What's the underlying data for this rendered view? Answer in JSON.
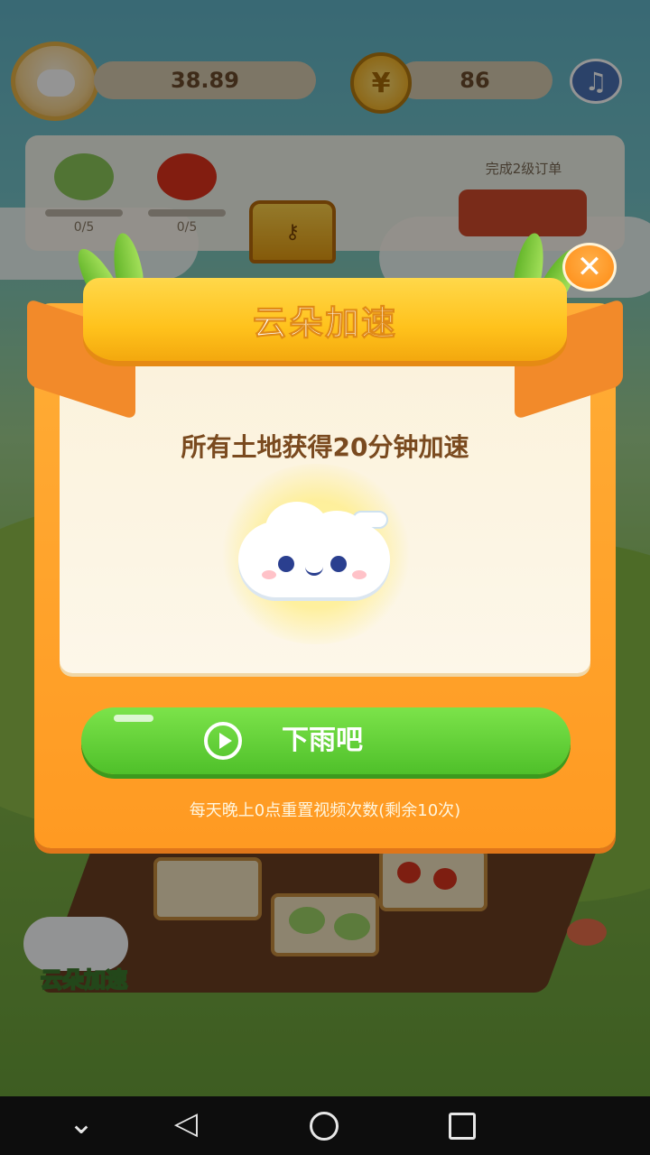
{
  "hud": {
    "balance": "38.89",
    "coins": "86",
    "coin_symbol": "¥",
    "music_icon": "♫"
  },
  "order_panel": {
    "items": [
      {
        "name": "cabbage",
        "progress": "0/5",
        "color": "#7bc04a"
      },
      {
        "name": "tomato",
        "progress": "0/5",
        "color": "#e0321c"
      }
    ],
    "title": "完成2级订单",
    "chest_icon": "⚷"
  },
  "scene": {
    "cloud_button_label": "云朵加速"
  },
  "dialog": {
    "title": "云朵加速",
    "close_symbol": "✕",
    "description": "所有土地获得20分钟加速",
    "action_label": "下雨吧",
    "reset_note": "每天晚上0点重置视频次数(剩余10次)",
    "colors": {
      "panel": "#ff9a22",
      "ribbon": "#ffc21c",
      "button": "#4fc02a",
      "description_text": "#7a4a1f"
    }
  },
  "navbar": {
    "down_icon": "⌄",
    "back_icon": "◁"
  }
}
